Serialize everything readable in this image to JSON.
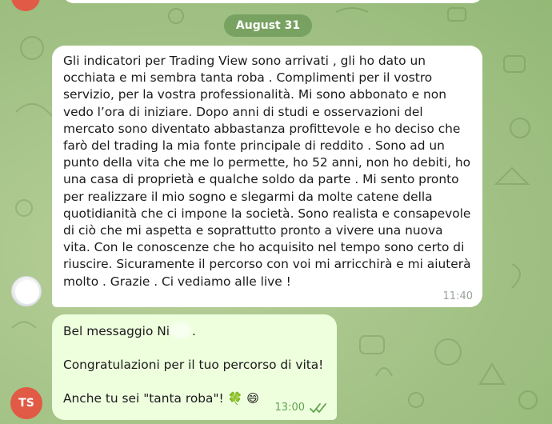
{
  "date_separator": "August 31",
  "incoming_message": {
    "text": "Gli indicatori per  Trading View sono arrivati , gli ho dato un occhiata e mi sembra tanta roba . Complimenti per il vostro servizio, per la vostra professionalità. Mi sono abbonato e non vedo l’ora di iniziare. Dopo anni di studi e osservazioni del mercato sono diventato abbastanza profittevole e ho deciso che farò del trading la mia fonte principale di reddito . Sono ad un punto della vita che me lo permette, ho 52 anni, non ho debiti, ho una casa di proprietà e qualche soldo da parte . Mi sento pronto per realizzare il mio sogno e slegarmi da molte catene della quotidianità che ci impone la società. Sono realista e consapevole di ciò che mi aspetta e soprattutto pronto a vivere una nuova vita. Con le conoscenze che ho acquisito nel tempo sono certo di riuscire. Sicuramente il percorso con voi mi arricchirà e mi aiuterà molto . Grazie . Ci vediamo alle live !",
    "time": "11:40"
  },
  "outgoing_message": {
    "line1_prefix": "Bel messaggio Ni",
    "line1_suffix": ".",
    "line2": "Congratulazioni per il tuo percorso di vita!",
    "line3": "Anche tu sei \"tanta roba\"! ",
    "emoji_clover": "🍀",
    "emoji_smile": "😄",
    "time": "13:00",
    "status_icon": "double-check-icon"
  },
  "sender_avatar_initials": "TS",
  "colors": {
    "outgoing_bubble": "#eeffde",
    "incoming_bubble": "#ffffff",
    "date_pill": "#6f9a58",
    "avatar_ts": "#e05a45",
    "check_color": "#5fa34f"
  }
}
